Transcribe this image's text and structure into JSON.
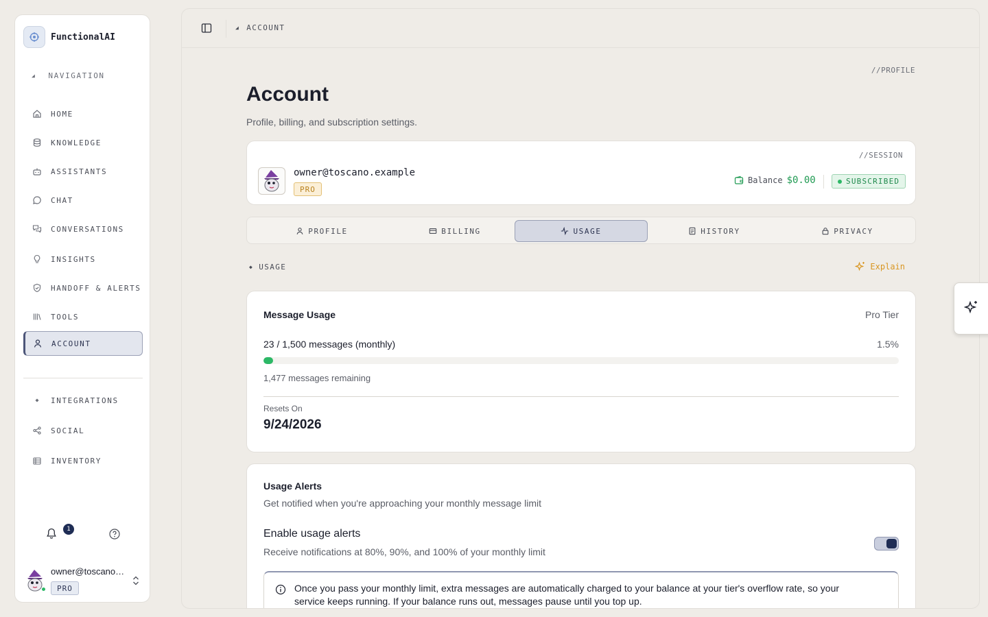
{
  "brand": {
    "name": "FunctionalAI"
  },
  "sidebar": {
    "nav_heading": "NAVIGATION",
    "items": [
      {
        "label": "HOME",
        "icon": "home-icon"
      },
      {
        "label": "KNOWLEDGE",
        "icon": "database-icon"
      },
      {
        "label": "ASSISTANTS",
        "icon": "bot-icon"
      },
      {
        "label": "CHAT",
        "icon": "chat-icon"
      },
      {
        "label": "CONVERSATIONS",
        "icon": "conversations-icon"
      },
      {
        "label": "INSIGHTS",
        "icon": "lightbulb-icon"
      },
      {
        "label": "HANDOFF & ALERTS",
        "icon": "shield-icon"
      },
      {
        "label": "TOOLS",
        "icon": "library-icon"
      },
      {
        "label": "ACCOUNT",
        "icon": "user-icon",
        "active": true
      }
    ],
    "secondary_items": [
      {
        "label": "INTEGRATIONS",
        "icon": "diamond-icon"
      },
      {
        "label": "SOCIAL",
        "icon": "share-icon"
      },
      {
        "label": "INVENTORY",
        "icon": "inventory-icon"
      }
    ],
    "notifications_count": "1",
    "user": {
      "email": "owner@toscano.example",
      "tier": "PRO"
    }
  },
  "topbar": {
    "breadcrumb": "ACCOUNT"
  },
  "page": {
    "tag": "//PROFILE",
    "title": "Account",
    "subtitle": "Profile, billing, and subscription settings."
  },
  "session": {
    "tag": "//SESSION",
    "email": "owner@toscano.example",
    "tier": "PRO",
    "balance_label": "Balance",
    "balance_amount": "$0.00",
    "status": "SUBSCRIBED"
  },
  "tabs": [
    {
      "label": "PROFILE",
      "icon": "user-icon"
    },
    {
      "label": "BILLING",
      "icon": "card-icon"
    },
    {
      "label": "USAGE",
      "icon": "activity-icon",
      "active": true
    },
    {
      "label": "HISTORY",
      "icon": "document-icon"
    },
    {
      "label": "PRIVACY",
      "icon": "lock-icon"
    }
  ],
  "section": {
    "heading": "USAGE",
    "explain": "Explain"
  },
  "usage": {
    "title": "Message Usage",
    "tier": "Pro Tier",
    "count": "23 / 1,500 messages (monthly)",
    "percent": "1.5%",
    "fill_fraction": 0.015,
    "remaining": "1,477 messages remaining",
    "resets_label": "Resets On",
    "resets_date": "9/24/2026"
  },
  "alerts": {
    "title": "Usage Alerts",
    "subtitle": "Get notified when you're approaching your monthly message limit",
    "enable_label": "Enable usage alerts",
    "enable_sub": "Receive notifications at 80%, 90%, and 100% of your monthly limit",
    "enabled": true,
    "info": "Once you pass your monthly limit, extra messages are automatically charged to your balance at your tier's overflow rate, so your service keeps running. If your balance runs out, messages pause until you top up."
  },
  "colors": {
    "accent": "#1f2d55",
    "success": "#2cb866",
    "warning": "#d99621",
    "background": "#efece7"
  }
}
